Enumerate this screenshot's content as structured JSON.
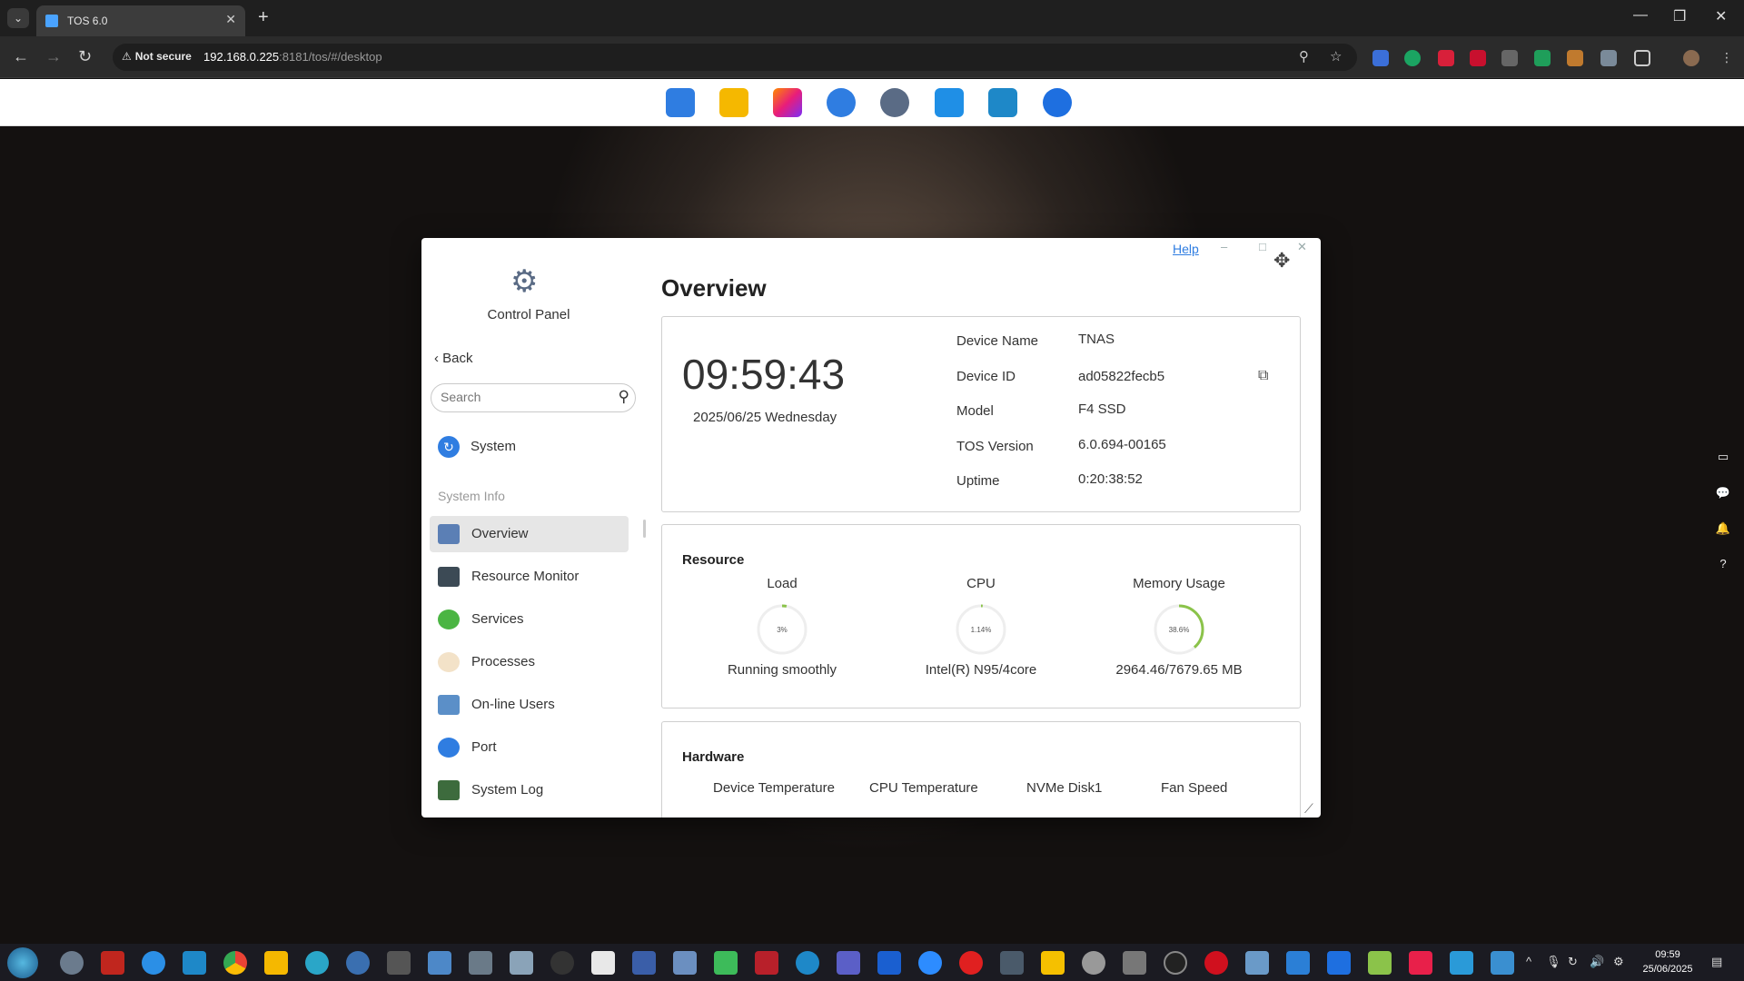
{
  "browser": {
    "tab_title": "TOS 6.0",
    "security_label": "Not secure",
    "url_host": "192.168.0.225",
    "url_rest": ":8181/tos/#/desktop"
  },
  "window": {
    "help_label": "Help",
    "app_title": "Control Panel"
  },
  "sidebar": {
    "back_label": "Back",
    "search_placeholder": "Search",
    "system_label": "System",
    "section_label": "System Info",
    "items": [
      {
        "label": "Overview",
        "icon": "monitor-icon",
        "color": "#5b7fb5"
      },
      {
        "label": "Resource Monitor",
        "icon": "chart-icon",
        "color": "#3c4a55"
      },
      {
        "label": "Services",
        "icon": "services-icon",
        "color": "#4bb543"
      },
      {
        "label": "Processes",
        "icon": "processes-icon",
        "color": "#e8a050"
      },
      {
        "label": "On-line Users",
        "icon": "users-icon",
        "color": "#5b8fc8"
      },
      {
        "label": "Port",
        "icon": "port-icon",
        "color": "#2f7de1"
      },
      {
        "label": "System Log",
        "icon": "log-icon",
        "color": "#3d6b3d"
      }
    ]
  },
  "overview": {
    "title": "Overview",
    "time": "09:59:43",
    "date": "2025/06/25 Wednesday",
    "device_name_label": "Device Name",
    "device_name": "TNAS",
    "device_id_label": "Device ID",
    "device_id": "ad05822fecb5",
    "model_label": "Model",
    "model": "F4 SSD",
    "tos_version_label": "TOS Version",
    "tos_version": "6.0.694-00165",
    "uptime_label": "Uptime",
    "uptime": "0:20:38:52"
  },
  "resource": {
    "title": "Resource",
    "load_label": "Load",
    "load_text": "3%",
    "load_value": 3,
    "load_status": "Running smoothly",
    "cpu_label": "CPU",
    "cpu_text": "1.14%",
    "cpu_value": 1.14,
    "cpu_model": "Intel(R) N95/4core",
    "mem_label": "Memory Usage",
    "mem_text": "38.6%",
    "mem_value": 38.6,
    "mem_detail": "2964.46/7679.65 MB",
    "gauge_color": "#8bc34a"
  },
  "hardware": {
    "title": "Hardware",
    "labels": [
      "Device Temperature",
      "CPU Temperature",
      "NVMe Disk1",
      "Fan Speed"
    ]
  },
  "taskbar": {
    "time": "09:59",
    "date": "25/06/2025"
  }
}
